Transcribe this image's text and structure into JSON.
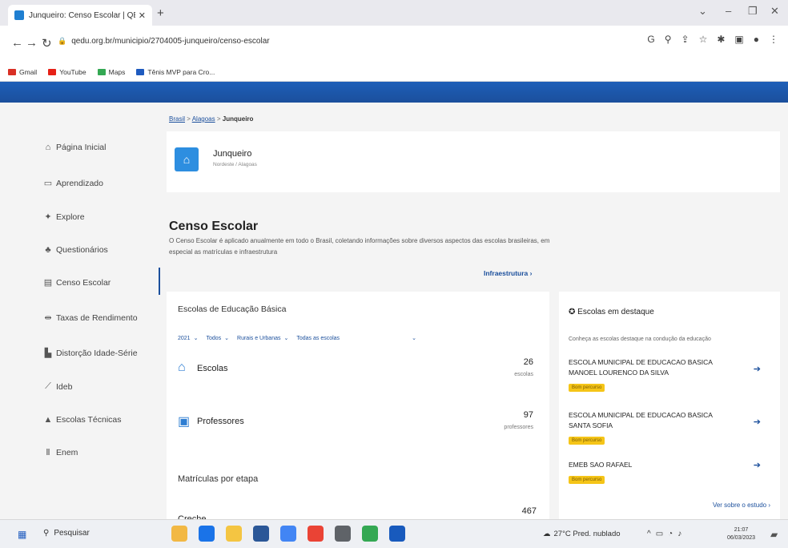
{
  "browser": {
    "tab_title": "Junqueiro: Censo Escolar | QEdu",
    "tab_close": "✕",
    "new_tab": "+",
    "url": "qedu.org.br/municipio/2704005-junqueiro/censo-escolar",
    "bookmarks": [
      "Gmail",
      "YouTube",
      "Maps",
      "Tênis MVP para Cro..."
    ],
    "window_controls": [
      "⌄",
      "–",
      "❐",
      "✕"
    ]
  },
  "sidebar": {
    "items": [
      {
        "label": "Página Inicial",
        "icon": "home-icon"
      },
      {
        "label": "Aprendizado",
        "icon": "book-icon"
      },
      {
        "label": "Explore",
        "icon": "explore-icon"
      },
      {
        "label": "Questionários",
        "icon": "people-icon"
      },
      {
        "label": "Censo Escolar",
        "icon": "census-icon"
      },
      {
        "label": "Taxas de Rendimento",
        "icon": "rates-icon"
      },
      {
        "label": "Distorção Idade-Série",
        "icon": "distortion-icon"
      },
      {
        "label": "Ideb",
        "icon": "chart-icon"
      },
      {
        "label": "Escolas Técnicas",
        "icon": "school-icon"
      },
      {
        "label": "Enem",
        "icon": "exam-icon"
      }
    ]
  },
  "breadcrumb": {
    "level1": "Brasil",
    "level2": "Alagoas",
    "level3": "Junqueiro",
    "sep": ">"
  },
  "city": {
    "name": "Junqueiro",
    "region": "Nordeste / Alagoas"
  },
  "censo": {
    "title": "Censo Escolar",
    "description": "O Censo Escolar é aplicado anualmente em todo o Brasil, coletando informações sobre diversos aspectos das escolas brasileiras, em especial as matrículas e infraestrutura",
    "infra_link": "Infraestrutura ›"
  },
  "basic": {
    "title": "Escolas de Educação Básica",
    "filters": [
      "2021",
      "Todos",
      "Rurais e Urbanas",
      "Todas as escolas"
    ],
    "escolas": {
      "label": "Escolas",
      "value": "26",
      "unit": "escolas"
    },
    "professores": {
      "label": "Professores",
      "value": "97",
      "unit": "professores"
    },
    "matriculas_title": "Matrículas por etapa",
    "creche": {
      "label": "Creche",
      "value": "467"
    }
  },
  "highlight": {
    "title": "Escolas em destaque",
    "subtitle": "Conheça as escolas destaque na condução da educação",
    "schools": [
      {
        "name": "ESCOLA MUNICIPAL DE EDUCACAO BASICA MANOEL LOURENCO DA SILVA",
        "badge": "Bom percurso"
      },
      {
        "name": "ESCOLA MUNICIPAL DE EDUCACAO BASICA SANTA SOFIA",
        "badge": "Bom percurso"
      },
      {
        "name": "EMEB SAO RAFAEL",
        "badge": "Bom percurso"
      }
    ],
    "more": "Ver sobre o estudo ›"
  },
  "taskbar": {
    "search": "Pesquisar",
    "weather": "27°C Pred. nublado",
    "time": "21:07",
    "date": "06/03/2023"
  }
}
